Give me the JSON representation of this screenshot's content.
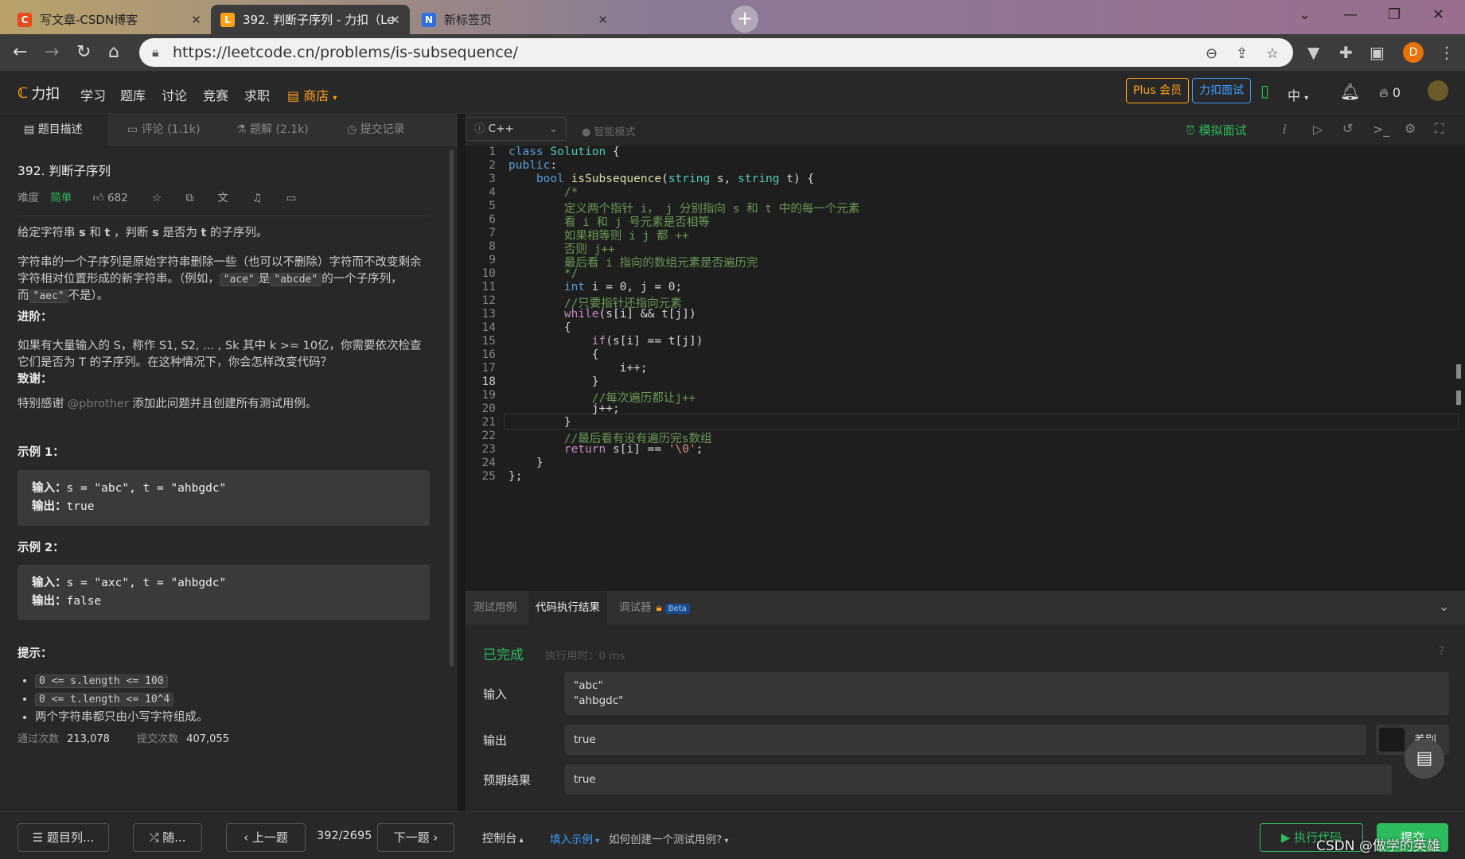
{
  "browser": {
    "tabs": [
      {
        "label": "写文章-CSDN博客",
        "favicon": "C",
        "color": "#e64a19"
      },
      {
        "label": "392. 判断子序列 - 力扣（LeetCo",
        "favicon": "L",
        "color": "#ffa116"
      },
      {
        "label": "新标签页",
        "favicon": "N",
        "color": "#2f6fe0"
      }
    ],
    "url": "https://leetcode.cn/problems/is-subsequence/",
    "profile_initial": "D"
  },
  "nav": {
    "logo": "力扣",
    "links": [
      "学习",
      "题库",
      "讨论",
      "竞赛",
      "求职"
    ],
    "shop": "商店",
    "plus": "Plus 会员",
    "interview": "力扣面试",
    "lang": "中",
    "points": "0"
  },
  "left": {
    "tabs": [
      "题目描述",
      "评论 (1.1k)",
      "题解 (2.1k)",
      "提交记录"
    ],
    "title": "392. 判断子序列",
    "difficulty_label": "难度",
    "difficulty": "简单",
    "likes": "682",
    "p1_a": "给定字符串 ",
    "p1_s": "s",
    "p1_b": " 和 ",
    "p1_t": "t",
    "p1_c": " ，判断 ",
    "p1_s2": "s",
    "p1_d": " 是否为 ",
    "p1_t2": "t",
    "p1_e": " 的子序列。",
    "p2_a": "字符串的一个子序列是原始字符串删除一些（也可以不删除）字符而不改变剩余字符相对位置形成的新字符串。（例如，",
    "p2_code1": "\"ace\"",
    "p2_b": "是",
    "p2_code2": "\"abcde\"",
    "p2_c": "的一个子序列，而",
    "p2_code3": "\"aec\"",
    "p2_d": "不是）。",
    "advanced_title": "进阶：",
    "advanced": "如果有大量输入的 S，称作 S1, S2, ... , Sk 其中 k >= 10亿，你需要依次检查它们是否为 T 的子序列。在这种情况下，你会怎样改变代码？",
    "thanks_title": "致谢：",
    "thanks_a": "特别感谢 ",
    "thanks_user": "@pbrother",
    "thanks_b": " 添加此问题并且创建所有测试用例。",
    "ex1_title": "示例 1：",
    "ex1_in_label": "输入：",
    "ex1_in": "s = \"abc\", t = \"ahbgdc\"",
    "ex1_out_label": "输出：",
    "ex1_out": "true",
    "ex2_title": "示例 2：",
    "ex2_in_label": "输入：",
    "ex2_in": "s = \"axc\", t = \"ahbgdc\"",
    "ex2_out_label": "输出：",
    "ex2_out": "false",
    "hints_title": "提示：",
    "hint1": "0 <= s.length <= 100",
    "hint2": "0 <= t.length <= 10^4",
    "hint3": "两个字符串都只由小写字符组成。",
    "accepted_label": "通过次数",
    "accepted": "213,078",
    "submitted_label": "提交次数",
    "submitted": "407,055"
  },
  "editor": {
    "language": "C++",
    "smart_mode": "智能模式",
    "mock_interview": "模拟面试",
    "current_line": 18
  },
  "results": {
    "tabs": [
      "测试用例",
      "代码执行结果",
      "调试器"
    ],
    "beta": "Beta",
    "status": "已完成",
    "runtime": "执行用时：0 ms",
    "input_label": "输入",
    "input_line1": "\"abc\"",
    "input_line2": "\"ahbgdc\"",
    "output_label": "输出",
    "output": "true",
    "diff": "差别",
    "expected_label": "预期结果",
    "expected": "true"
  },
  "bottom": {
    "problem_list": "题目列...",
    "random": "随...",
    "prev": "上一题",
    "page": "392/2695",
    "next": "下一题",
    "console": "控制台",
    "fill_example": "填入示例",
    "how_to": "如何创建一个测试用例?",
    "run": "执行代码",
    "submit": "提交",
    "watermark": "CSDN @做学的英雄"
  }
}
